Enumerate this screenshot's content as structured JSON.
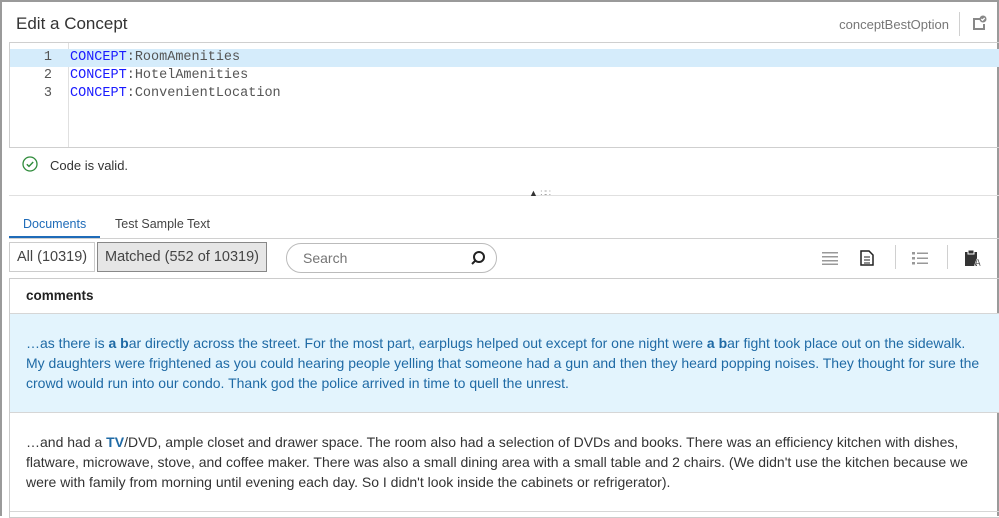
{
  "header": {
    "title": "Edit a Concept",
    "concept_name": "conceptBestOption"
  },
  "editor": {
    "lines": [
      {
        "num": "1",
        "keyword": "CONCEPT",
        "rest": ":RoomAmenities"
      },
      {
        "num": "2",
        "keyword": "CONCEPT",
        "rest": ":HotelAmenities"
      },
      {
        "num": "3",
        "keyword": "CONCEPT",
        "rest": ":ConvenientLocation"
      }
    ]
  },
  "status": {
    "text": "Code is valid.",
    "color": "#2e8b3a"
  },
  "tabs": [
    {
      "label": "Documents"
    },
    {
      "label": "Test Sample Text"
    }
  ],
  "filters": {
    "all": "All (10319)",
    "matched": "Matched (552 of 10319)"
  },
  "search": {
    "placeholder": "Search"
  },
  "table": {
    "column": "comments",
    "rows": [
      {
        "parts": [
          "…as there is ",
          "a b",
          "ar directly across the street. For the most part, earplugs helped out except for one night were ",
          "a b",
          "ar fight took place out on the sidewalk. My daughters were frightened as you could hearing people yelling that someone had a gun and then they heard popping noises. They thought for sure the crowd would run into our condo. Thank god the police arrived in time to quell the unrest."
        ]
      },
      {
        "parts": [
          "…and had a ",
          "TV",
          "/DVD, ample closet and drawer space. The room also had a selection of DVDs and books. There was an efficiency kitchen with dishes, flatware, microwave, stove, and coffee maker. There was also a small dining area with a small table and 2 chairs. (We didn't use the kitchen because we were with family from morning until evening each day. So I didn't look inside the cabinets or refrigerator)."
        ]
      }
    ]
  }
}
